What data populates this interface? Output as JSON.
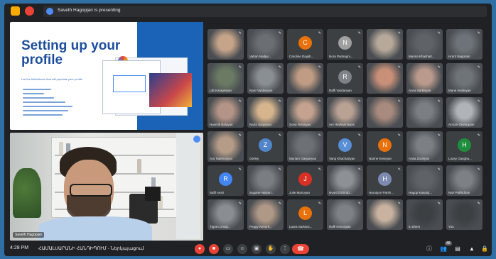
{
  "presenting_bar": {
    "text": "Saveth Hagopjan is presenting"
  },
  "slide": {
    "title": "Setting up your profile",
    "subtitle": "List the fields/items that will populate your profile"
  },
  "camera": {
    "name": "Saveth Hagopjan"
  },
  "participants": [
    {
      "name": "",
      "initial": "",
      "color": "#c6a48a"
    },
    {
      "name": "Vahan Nadjar...",
      "initial": "",
      "color": "#6b6f74"
    },
    {
      "name": "Caroline Dayjih...",
      "initial": "C",
      "color": "#e8710a"
    },
    {
      "name": "Nora Parisagni...",
      "initial": "N",
      "color": "#a0a0a0"
    },
    {
      "name": "",
      "initial": "",
      "color": "#b7a99a"
    },
    {
      "name": "Marina Khachatr...",
      "initial": "",
      "color": "#5f6368"
    },
    {
      "name": "Hrant Nagorian",
      "initial": "",
      "color": "#6d7378"
    },
    {
      "name": "Lilit Karapetyan",
      "initial": "",
      "color": "#6b7a63"
    },
    {
      "name": "Nare Vardanyan",
      "initial": "",
      "color": "#8a8f94"
    },
    {
      "name": "",
      "initial": "",
      "color": "#c09c84"
    },
    {
      "name": "Raffi Vardanyan",
      "initial": "R",
      "color": "#7e8387"
    },
    {
      "name": "",
      "initial": "",
      "color": "#c88f79"
    },
    {
      "name": "Anna Sarkisyan",
      "initial": "",
      "color": "#b99a8c"
    },
    {
      "name": "Mane Avetisyan",
      "initial": "",
      "color": "#6f7478"
    },
    {
      "name": "Hasmik Baloyan",
      "initial": "",
      "color": "#b49486"
    },
    {
      "name": "Naira Sargsyan",
      "initial": "",
      "color": "#d5b48e"
    },
    {
      "name": "Sona Yeranyan",
      "initial": "",
      "color": "#c4a28f"
    },
    {
      "name": "Ani Hovhannisyan",
      "initial": "",
      "color": "#b9a194"
    },
    {
      "name": "",
      "initial": "",
      "color": "#a88a7e"
    },
    {
      "name": "",
      "initial": "",
      "color": "#7b7f83"
    },
    {
      "name": "Arman Gevorgyan",
      "initial": "",
      "color": "#b0b4b8"
    },
    {
      "name": "Ara Tadevosyan",
      "initial": "",
      "color": "#b59c88"
    },
    {
      "name": "Gerley",
      "initial": "Z",
      "color": "#5184c9"
    },
    {
      "name": "Mariam Gasparyan",
      "initial": "",
      "color": "#6d7176"
    },
    {
      "name": "Varuj Khachatryan",
      "initial": "V",
      "color": "#5a8fd6"
    },
    {
      "name": "Narine Keseyan",
      "initial": "N",
      "color": "#e8710a"
    },
    {
      "name": "Anita Zarafyan",
      "initial": "",
      "color": "#7c8085"
    },
    {
      "name": "Lousy Gasgha...",
      "initial": "H",
      "color": "#1e8e3e"
    },
    {
      "name": "Saffi Ansri",
      "initial": "R",
      "color": "#4285f4"
    },
    {
      "name": "Sugane Nalyan...",
      "initial": "",
      "color": "#7a7e83"
    },
    {
      "name": "Julie Manoyan",
      "initial": "J",
      "color": "#d93025"
    },
    {
      "name": "Nvard Dzhindz...",
      "initial": "",
      "color": "#8d9196"
    },
    {
      "name": "Harutyun Parsh...",
      "initial": "H",
      "color": "#7d8bb0"
    },
    {
      "name": "Hagop Kasanji...",
      "initial": "",
      "color": "#5f6368"
    },
    {
      "name": "Nair Pahlichian",
      "initial": "",
      "color": "#7d8185"
    },
    {
      "name": "Tigran Limaji...",
      "initial": "",
      "color": "#8a8e92"
    },
    {
      "name": "Peggy Kevork...",
      "initial": "",
      "color": "#b09887"
    },
    {
      "name": "Laura Sarkissi...",
      "initial": "L",
      "color": "#e8710a"
    },
    {
      "name": "Raffi Kevorgian",
      "initial": "",
      "color": "#7e8286"
    },
    {
      "name": "",
      "initial": "",
      "color": "#c9b2a0"
    },
    {
      "name": "6 others",
      "initial": "",
      "color": "#3c4043"
    },
    {
      "name": "You",
      "initial": "",
      "color": "#3c4043"
    }
  ],
  "bottom": {
    "time": "4:28 PM",
    "meeting": "ՀԱՄԱԼՍԱՐԱՆԻ ՀԱՆԴԻՊՈՒՄ - Ներկայացում",
    "people_count": "48"
  }
}
